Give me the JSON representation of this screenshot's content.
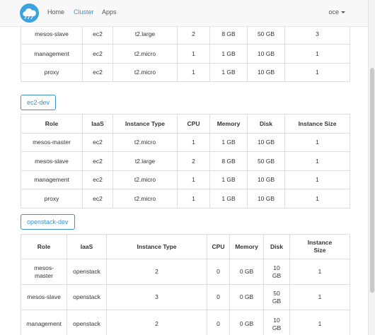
{
  "nav": {
    "home": "Home",
    "cluster": "Cluster",
    "apps": "Apps",
    "user": "oce"
  },
  "columns": [
    "Role",
    "IaaS",
    "Instance Type",
    "CPU",
    "Memory",
    "Disk",
    "Instance Size"
  ],
  "clusters": [
    {
      "rows": [
        [
          "mesos-slave",
          "ec2",
          "t2.large",
          "2",
          "8 GB",
          "50 GB",
          "3"
        ],
        [
          "management",
          "ec2",
          "t2.micro",
          "1",
          "1 GB",
          "10 GB",
          "1"
        ],
        [
          "proxy",
          "ec2",
          "t2.micro",
          "1",
          "1 GB",
          "10 GB",
          "1"
        ]
      ]
    },
    {
      "name": "ec2-dev",
      "rows": [
        [
          "mesos-master",
          "ec2",
          "t2.micro",
          "1",
          "1 GB",
          "10 GB",
          "1"
        ],
        [
          "mesos-slave",
          "ec2",
          "t2.large",
          "2",
          "8 GB",
          "50 GB",
          "1"
        ],
        [
          "management",
          "ec2",
          "t2.micro",
          "1",
          "1 GB",
          "10 GB",
          "1"
        ],
        [
          "proxy",
          "ec2",
          "t2.micro",
          "1",
          "1 GB",
          "10 GB",
          "1"
        ]
      ]
    },
    {
      "name": "openstack-dev",
      "columns": [
        "Role",
        "IaaS",
        "Instance Type",
        "CPU",
        "Memory",
        "Disk",
        "Instance Size"
      ],
      "rows": [
        [
          "mesos-master",
          "openstack",
          "2",
          "0",
          "0 GB",
          "10 GB",
          "1"
        ],
        [
          "mesos-slave",
          "openstack",
          "3",
          "0",
          "0 GB",
          "50 GB",
          "1"
        ],
        [
          "management",
          "openstack",
          "2",
          "0",
          "0 GB",
          "10 GB",
          "1"
        ]
      ]
    }
  ],
  "colors": {
    "accent": "#3b8fd6",
    "navbar_bg": "#f8f8f8",
    "border": "#dddddd",
    "logo": "#3aa3e0"
  },
  "icons": [
    "cloud-logo-icon",
    "caret-down-icon"
  ]
}
